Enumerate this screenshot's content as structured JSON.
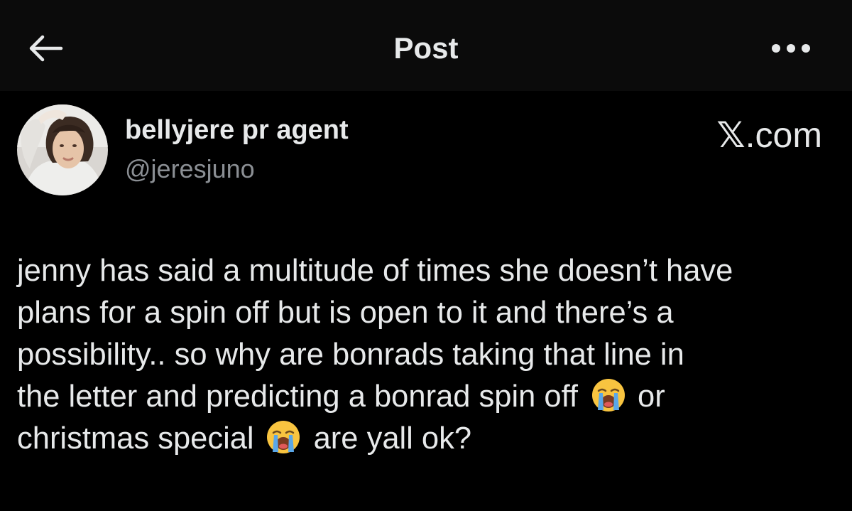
{
  "header": {
    "title": "Post",
    "back_icon": "arrow-left-icon",
    "more_icon": "more-dots-icon"
  },
  "author": {
    "display_name": "bellyjere pr agent",
    "handle": "@jeresjuno",
    "avatar_icon": "avatar-photo"
  },
  "watermark": {
    "logo": "𝕏",
    "suffix": ".com"
  },
  "post": {
    "lines": [
      {
        "pre": "jenny has said a multitude of times she doesn’t have"
      },
      {
        "pre": "plans for a spin off but is open to it and there’s a"
      },
      {
        "pre": "possibility.. so why are bonrads taking that line in"
      },
      {
        "pre": "the letter and predicting a bonrad spin off",
        "emoji": "loudly-crying-face-icon",
        "post": "or"
      },
      {
        "pre": "christmas special",
        "emoji": "loudly-crying-face-icon",
        "post": "are yall ok?"
      }
    ]
  },
  "colors": {
    "background": "#000000",
    "header_bg": "#0b0b0b",
    "text": "#e7e9ea",
    "secondary_text": "#8b8f94",
    "emoji_yellow": "#f8c440",
    "emoji_tears": "#5aa7e8"
  }
}
